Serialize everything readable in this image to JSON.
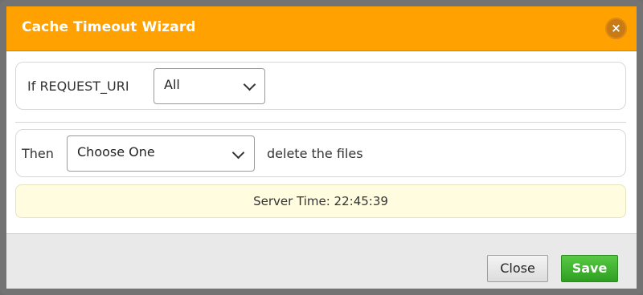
{
  "dialog": {
    "title": "Cache Timeout Wizard",
    "close_icon_glyph": "×"
  },
  "condition": {
    "label": "If REQUEST_URI",
    "select_value": "All"
  },
  "action": {
    "label": "Then",
    "select_value": "Choose One",
    "suffix": "delete the files"
  },
  "status": {
    "server_time": "Server Time: 22:45:39"
  },
  "footer": {
    "close_label": "Close",
    "save_label": "Save"
  },
  "colors": {
    "title_bar": "#ffa100",
    "save_button": "#3aae2c",
    "time_bar": "#fffce0"
  },
  "icons": [
    "close-x-icon",
    "chevron-down-icon"
  ]
}
